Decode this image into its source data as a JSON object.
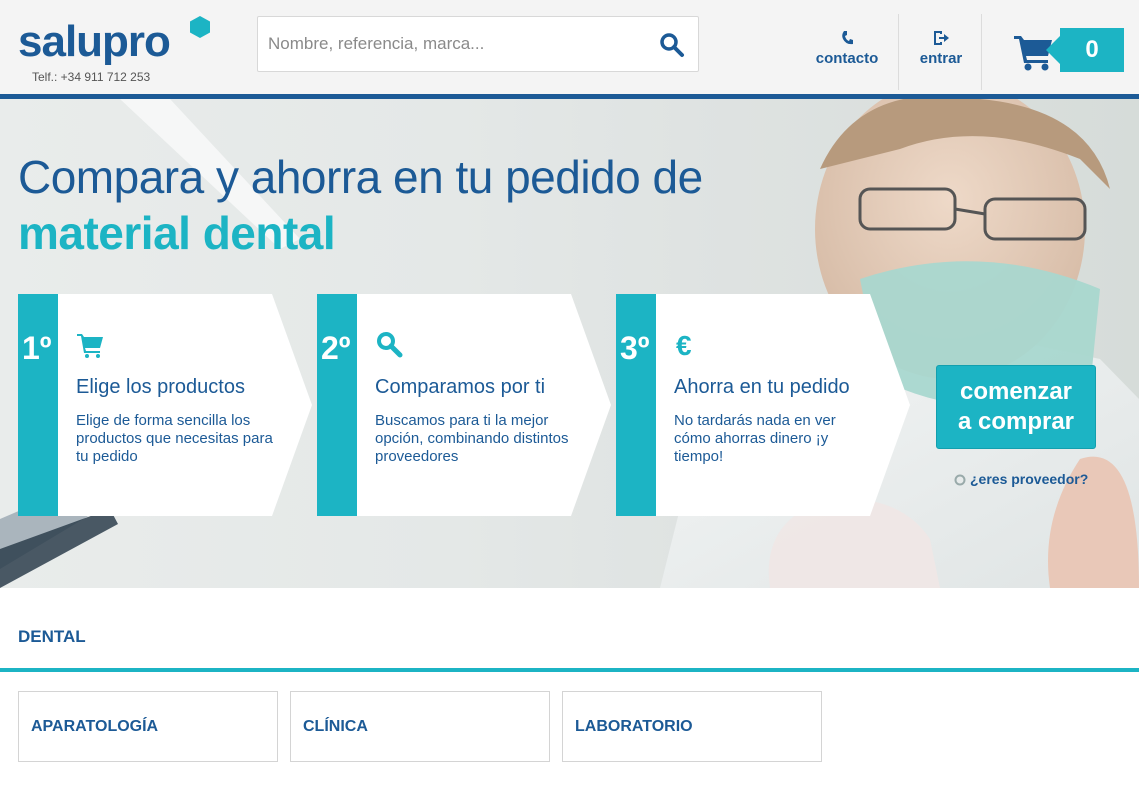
{
  "header": {
    "logo": "salupro",
    "phone": "Telf.: +34 911 712 253",
    "search_placeholder": "Nombre, referencia, marca...",
    "contact_label": "contacto",
    "login_label": "entrar",
    "cart_count": "0"
  },
  "hero": {
    "title_line1": "Compara y ahorra en tu pedido de",
    "title_line2": "material dental",
    "steps": [
      {
        "number": "1º",
        "icon": "cart-icon",
        "title": "Elige los productos",
        "text": "Elige de forma sencilla los productos que necesitas para tu pedido"
      },
      {
        "number": "2º",
        "icon": "search-icon",
        "title": "Comparamos por ti",
        "text": "Buscamos para ti la mejor opción, combinando distintos proveedores"
      },
      {
        "number": "3º",
        "icon": "euro-icon",
        "title": "Ahorra en tu pedido",
        "text": "No tardarás nada en ver cómo ahorras dinero ¡y tiempo!"
      }
    ],
    "cta_line1": "comenzar",
    "cta_line2": "a comprar",
    "provider_link": "¿eres proveedor?"
  },
  "category": {
    "title": "DENTAL",
    "items": [
      "APARATOLOGÍA",
      "CLÍNICA",
      "LABORATORIO"
    ]
  },
  "colors": {
    "primary": "#1c5a96",
    "accent": "#1cb4c4"
  }
}
